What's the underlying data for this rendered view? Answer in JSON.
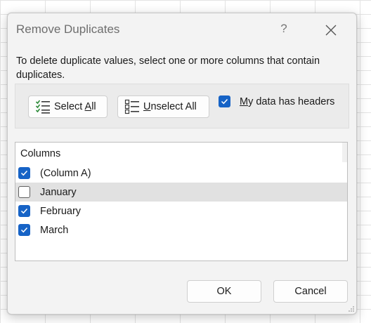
{
  "dialog": {
    "title": "Remove Duplicates",
    "help_glyph": "?",
    "instructions": "To delete duplicate values, select one or more columns that contain duplicates."
  },
  "options": {
    "select_all": {
      "access_key": "A",
      "label_before": "Select ",
      "label_after": "ll",
      "icon": "select-all-icon"
    },
    "unselect_all": {
      "access_key": "U",
      "label_before": "",
      "label_after": "nselect All",
      "icon": "unselect-all-icon"
    },
    "headers": {
      "access_key": "M",
      "label_rest": "y data has headers",
      "checked": true
    }
  },
  "columns": {
    "header": "Columns",
    "items": [
      {
        "label": "(Column A)",
        "checked": true,
        "highlighted": false
      },
      {
        "label": "January",
        "checked": false,
        "highlighted": true
      },
      {
        "label": "February",
        "checked": true,
        "highlighted": false
      },
      {
        "label": "March",
        "checked": true,
        "highlighted": false
      }
    ]
  },
  "footer": {
    "ok_label": "OK",
    "cancel_label": "Cancel"
  },
  "colors": {
    "accent": "#1663c6",
    "dialog_bg": "#f3f3f3",
    "highlight_row": "#e1e1e1"
  }
}
